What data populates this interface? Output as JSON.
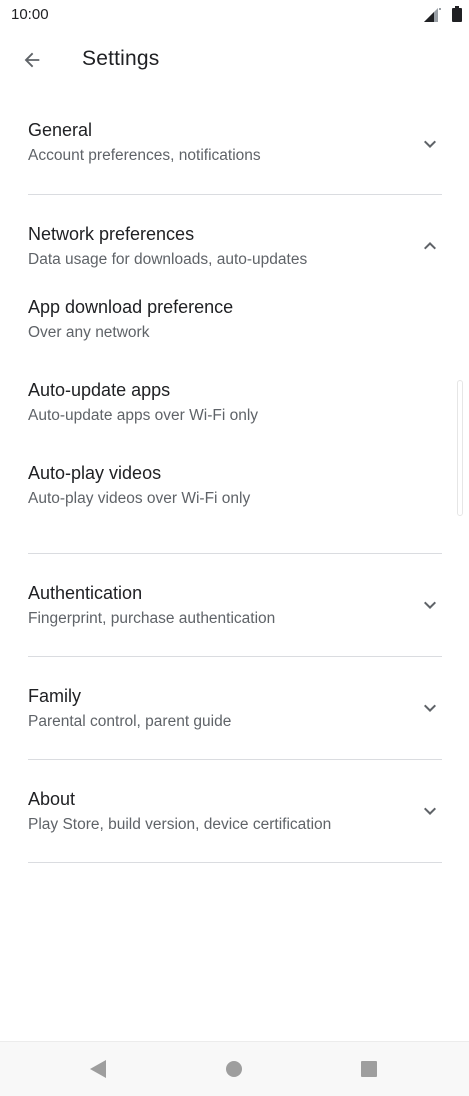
{
  "status_bar": {
    "time": "10:00"
  },
  "app_bar": {
    "title": "Settings"
  },
  "sections": [
    {
      "title": "General",
      "subtitle": "Account preferences, notifications",
      "expanded": false
    },
    {
      "title": "Network preferences",
      "subtitle": "Data usage for downloads, auto-updates",
      "expanded": true,
      "items": [
        {
          "title": "App download preference",
          "subtitle": "Over any network"
        },
        {
          "title": "Auto-update apps",
          "subtitle": "Auto-update apps over Wi-Fi only"
        },
        {
          "title": "Auto-play videos",
          "subtitle": "Auto-play videos over Wi-Fi only"
        }
      ]
    },
    {
      "title": "Authentication",
      "subtitle": "Fingerprint, purchase authentication",
      "expanded": false
    },
    {
      "title": "Family",
      "subtitle": "Parental control, parent guide",
      "expanded": false
    },
    {
      "title": "About",
      "subtitle": "Play Store, build version, device certification",
      "expanded": false
    }
  ],
  "icons": {
    "back": "arrow-back-icon",
    "expand": "chevron-down-icon",
    "collapse": "chevron-up-icon",
    "signal": "signal-icon",
    "battery": "battery-icon"
  },
  "colors": {
    "text_primary": "#202124",
    "text_secondary": "#5f6368",
    "divider": "#dadce0",
    "icon": "#5f6368"
  }
}
